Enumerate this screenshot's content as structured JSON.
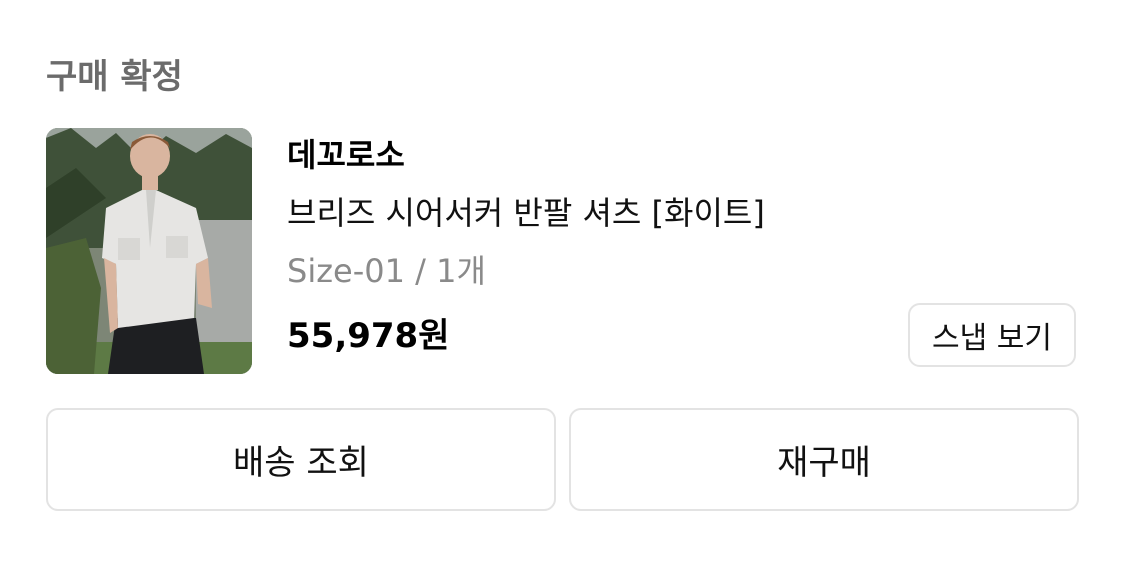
{
  "order": {
    "status": "구매 확정"
  },
  "product": {
    "brand": "데꼬로소",
    "name": "브리즈 시어서커 반팔 셔츠 [화이트]",
    "option": "Size-01 / 1개",
    "price": "55,978원",
    "image_alt": "model wearing white short-sleeve shirt"
  },
  "buttons": {
    "snap": "스냅 보기",
    "tracking": "배송 조회",
    "reorder": "재구매"
  },
  "colors": {
    "status_text": "#6b6b6b",
    "option_text": "#8a8a8a",
    "border": "#e3e3e3"
  }
}
